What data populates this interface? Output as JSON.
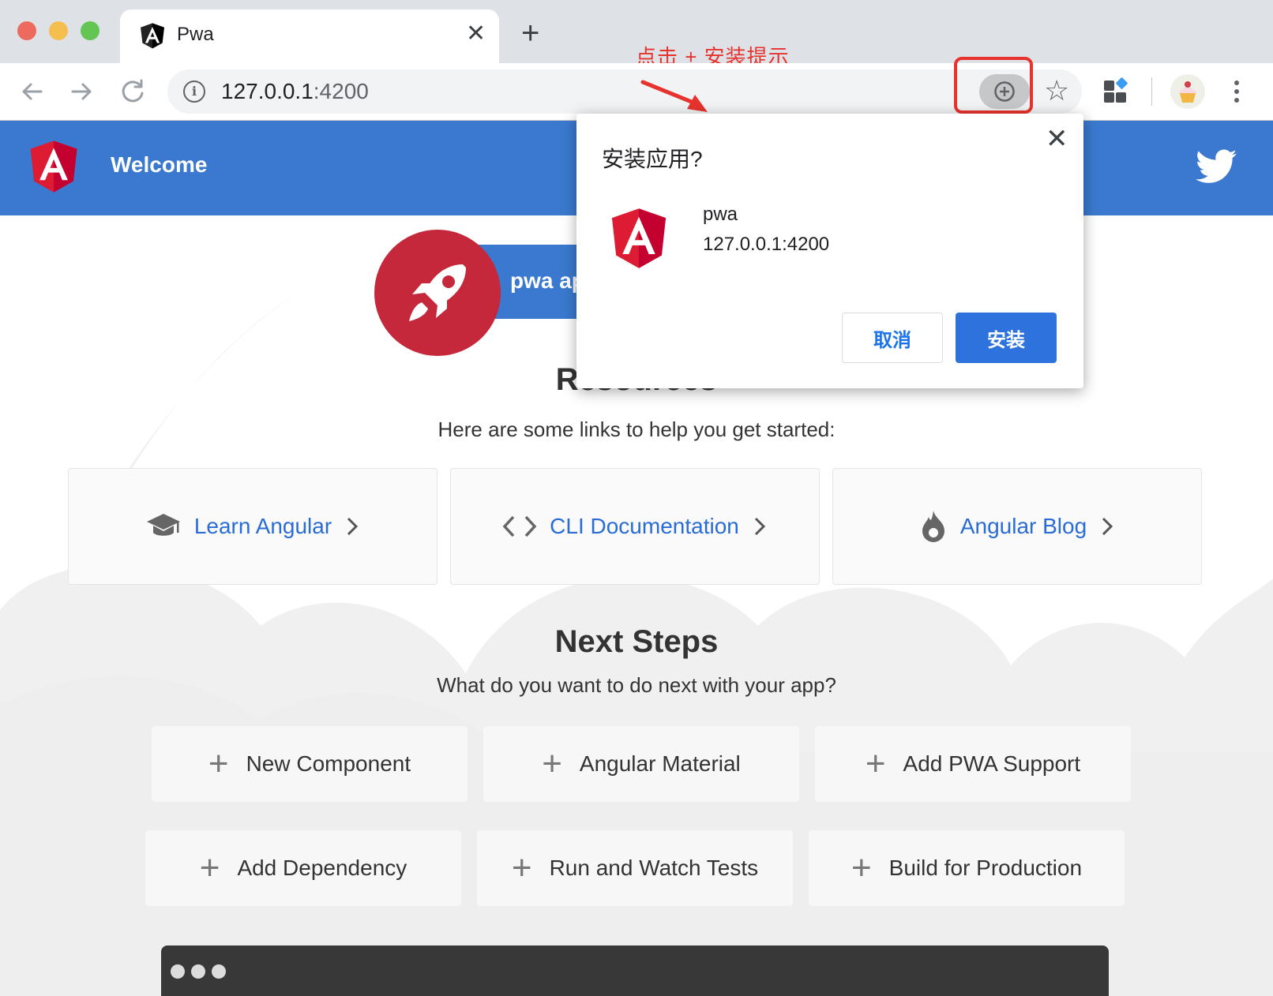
{
  "browser": {
    "tab": {
      "title": "Pwa",
      "close_glyph": "✕"
    },
    "new_tab_glyph": "+",
    "url": {
      "host": "127.0.0.1",
      "port": ":4200"
    },
    "star_glyph": "☆",
    "annotation": "点击 + 安装提示",
    "annotation_color": "#e7332e"
  },
  "page": {
    "topbar_title": "Welcome",
    "banner_text": "pwa ap",
    "resources": {
      "title": "Resources",
      "subtitle": "Here are some links to help you get started:",
      "cards": [
        {
          "label": "Learn Angular",
          "icon": "graduation-cap-icon"
        },
        {
          "label": "CLI Documentation",
          "icon": "code-icon"
        },
        {
          "label": "Angular Blog",
          "icon": "flame-icon"
        }
      ]
    },
    "next_steps": {
      "title": "Next Steps",
      "subtitle": "What do you want to do next with your app?",
      "cards": [
        {
          "label": "New Component"
        },
        {
          "label": "Angular Material"
        },
        {
          "label": "Add PWA Support"
        },
        {
          "label": "Add Dependency"
        },
        {
          "label": "Run and Watch Tests"
        },
        {
          "label": "Build for Production"
        }
      ]
    },
    "brand_color": "#3a79cf",
    "accent_red": "#c4283a"
  },
  "dialog": {
    "title": "安装应用?",
    "app_name": "pwa",
    "app_url": "127.0.0.1:4200",
    "cancel_label": "取消",
    "install_label": "安装",
    "close_glyph": "✕"
  }
}
